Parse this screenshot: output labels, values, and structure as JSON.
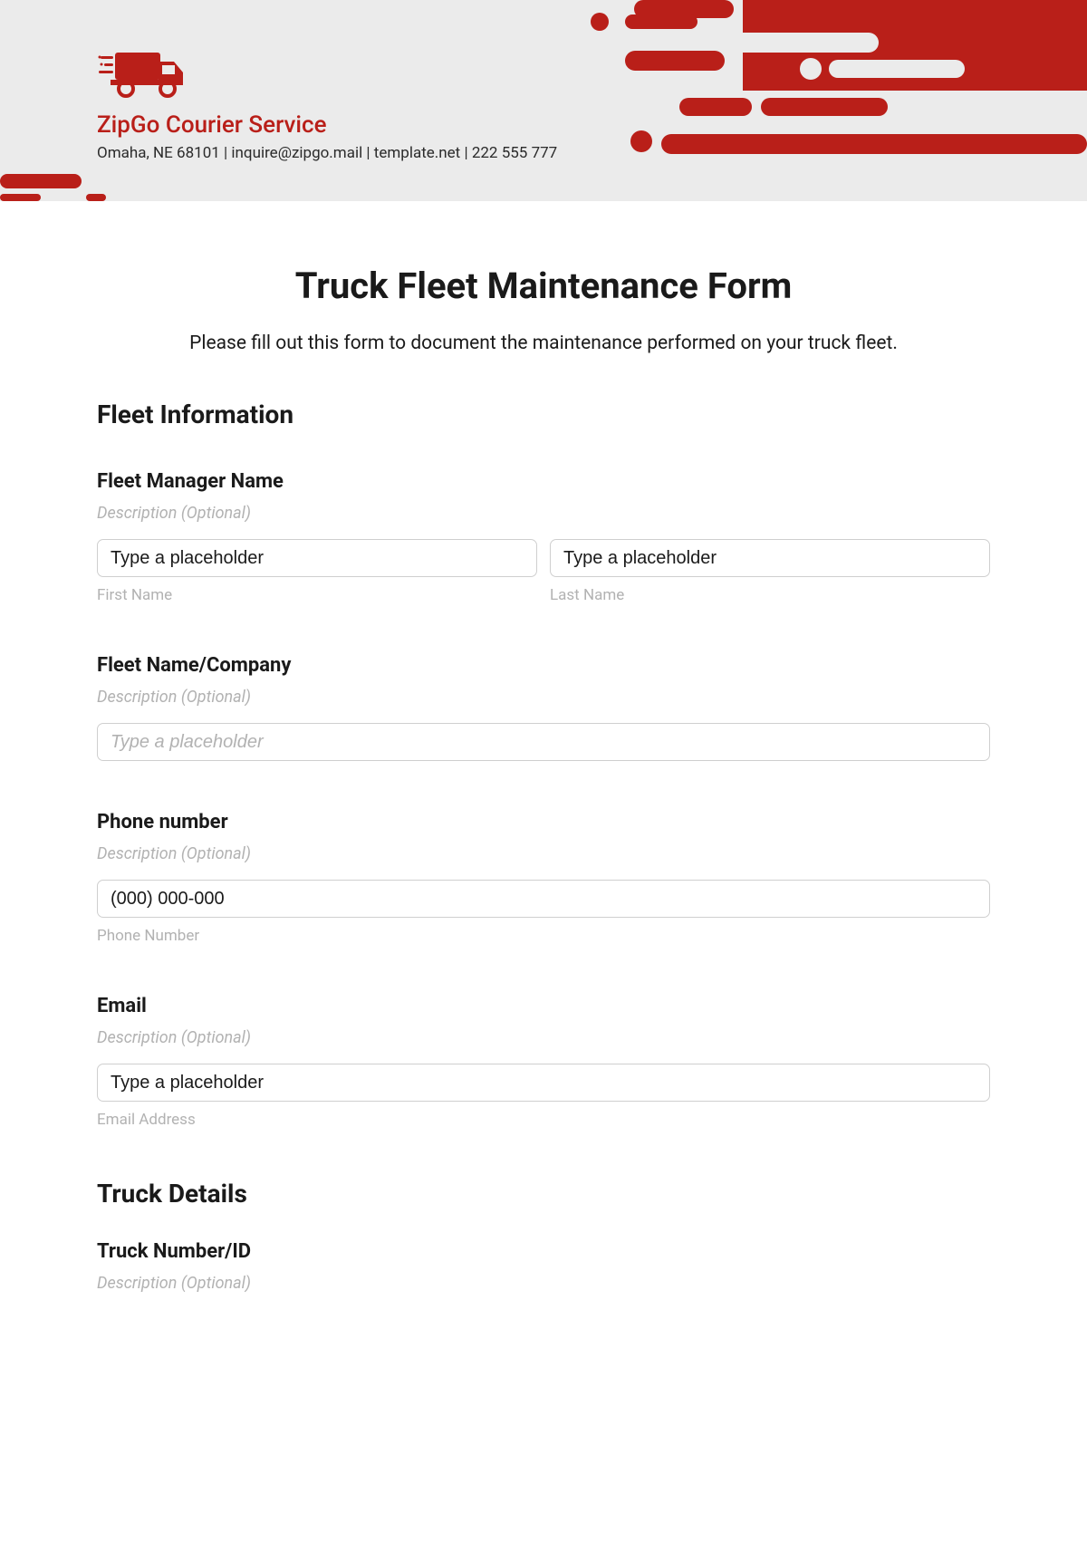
{
  "header": {
    "company_name": "ZipGo Courier Service",
    "company_info": "Omaha, NE 68101 | inquire@zipgo.mail | template.net | 222 555 777",
    "brand_color": "#b91f19"
  },
  "form": {
    "title": "Truck Fleet Maintenance Form",
    "subtitle": "Please fill out this form to document the maintenance performed on your truck fleet."
  },
  "section1": {
    "heading": "Fleet Information",
    "manager": {
      "label": "Fleet Manager Name",
      "desc": "Description (Optional)",
      "first_value": "Type a placeholder",
      "first_sublabel": "First Name",
      "last_value": "Type a placeholder",
      "last_sublabel": "Last Name"
    },
    "company": {
      "label": "Fleet Name/Company",
      "desc": "Description (Optional)",
      "placeholder": "Type a placeholder"
    },
    "phone": {
      "label": "Phone number",
      "desc": "Description (Optional)",
      "value": "(000) 000-000",
      "sublabel": "Phone Number"
    },
    "email": {
      "label": "Email",
      "desc": "Description (Optional)",
      "value": "Type a placeholder",
      "sublabel": "Email Address"
    }
  },
  "section2": {
    "heading": "Truck Details",
    "truck_id": {
      "label": "Truck Number/ID",
      "desc": "Description (Optional)"
    }
  }
}
